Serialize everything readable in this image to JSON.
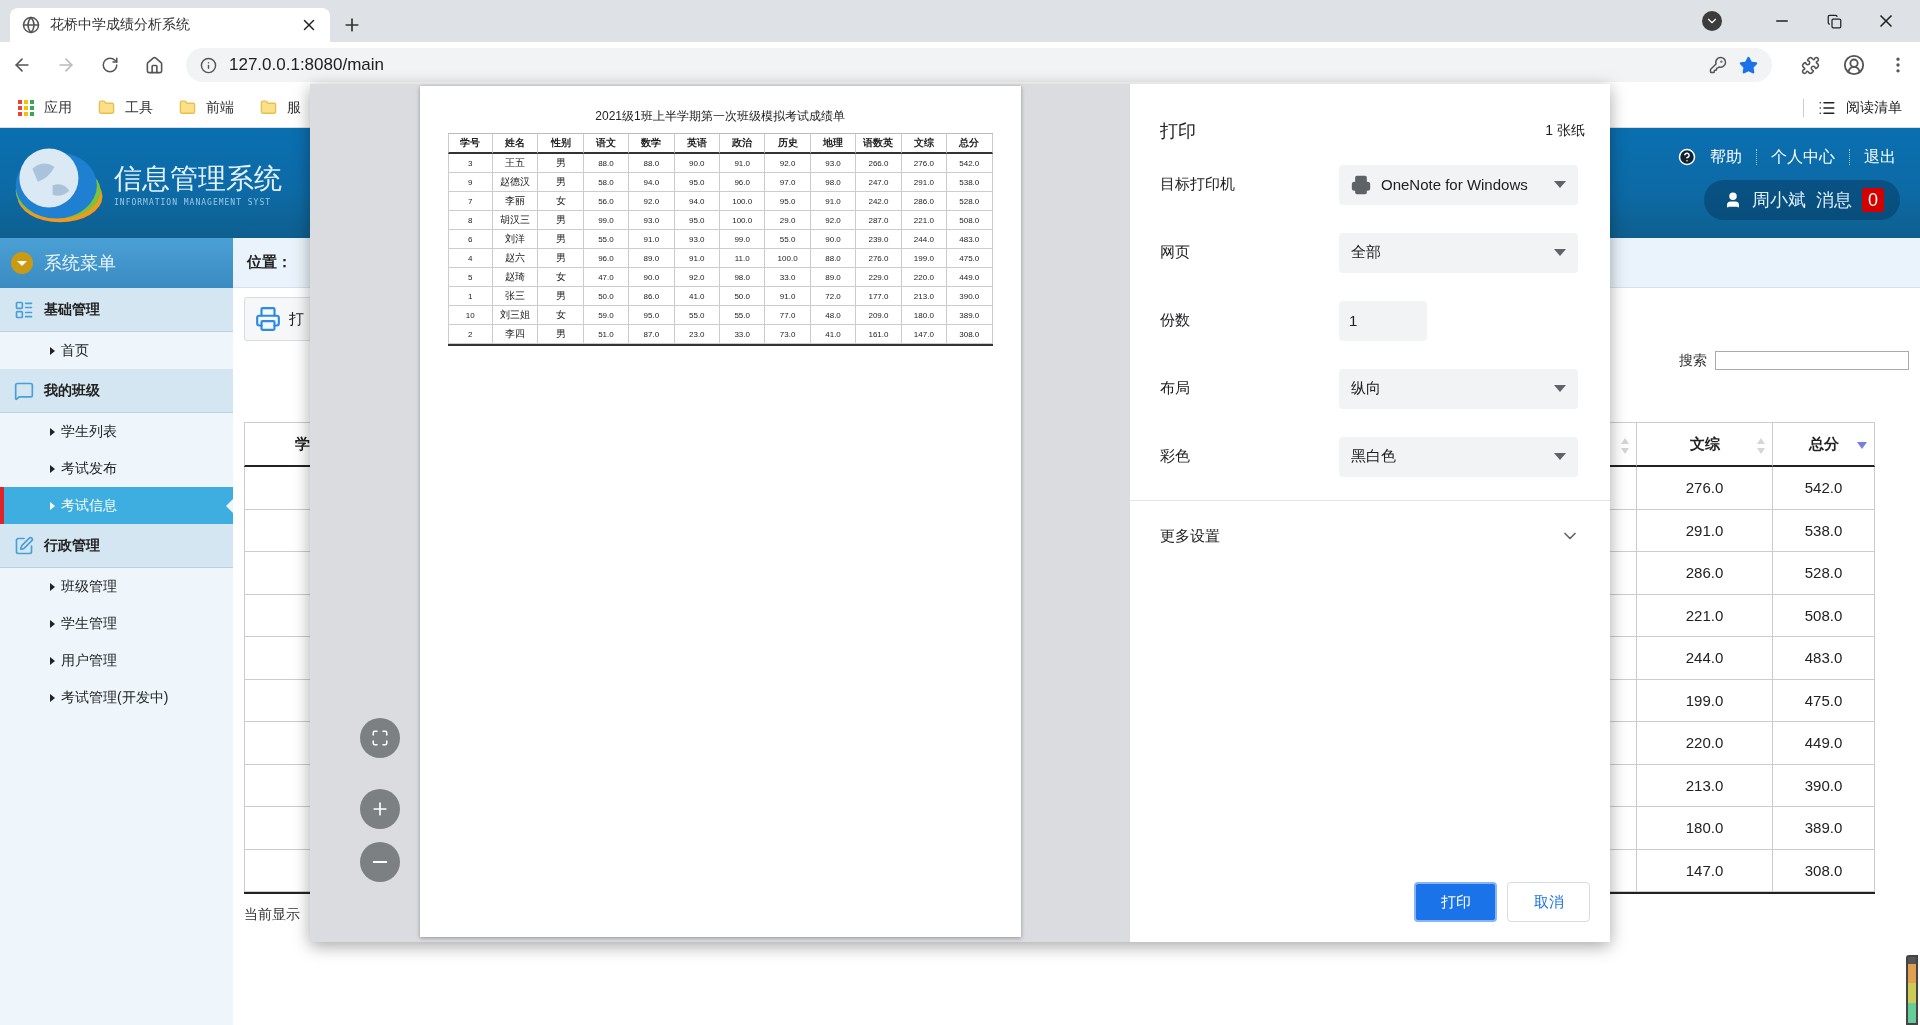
{
  "browser": {
    "tab_title": "花桥中学成绩分析系统",
    "url": "127.0.0.1:8080/main",
    "bookmarked": true,
    "bookmarks": [
      {
        "label": "应用",
        "kind": "apps"
      },
      {
        "label": "工具",
        "kind": "folder"
      },
      {
        "label": "前端",
        "kind": "folder"
      },
      {
        "label": "服",
        "kind": "folder"
      }
    ],
    "reading_list": "阅读清单"
  },
  "header": {
    "title": "信息管理系统",
    "subtitle": "INFORMATION MANAGEMENT SYST",
    "links": [
      {
        "label": "帮助",
        "kind": "help"
      },
      {
        "label": "个人中心",
        "kind": "plain"
      },
      {
        "label": "退出",
        "kind": "plain"
      }
    ],
    "user": "周小斌",
    "messages_label": "消息",
    "message_count": "0"
  },
  "sidebar": {
    "title": "系统菜单",
    "groups": [
      {
        "label": "基础管理",
        "items": [
          {
            "label": "首页",
            "selected": false
          }
        ]
      },
      {
        "label": "我的班级",
        "items": [
          {
            "label": "学生列表",
            "selected": false
          },
          {
            "label": "考试发布",
            "selected": false
          },
          {
            "label": "考试信息",
            "selected": true
          }
        ]
      },
      {
        "label": "行政管理",
        "items": [
          {
            "label": "班级管理",
            "selected": false
          },
          {
            "label": "学生管理",
            "selected": false
          },
          {
            "label": "用户管理",
            "selected": false
          },
          {
            "label": "考试管理(开发中)",
            "selected": false
          }
        ]
      }
    ]
  },
  "main": {
    "location_label": "位置：",
    "print_button": "打",
    "search_label": "搜索",
    "table": {
      "columns": [
        {
          "label": "学"
        },
        {
          "sortable": true,
          "sorted": false
        },
        {
          "label": "文综",
          "sortable": true,
          "sorted": false
        },
        {
          "label": "总分",
          "sortable": true,
          "sorted": true
        }
      ],
      "rows": [
        [
          "276.0",
          "542.0"
        ],
        [
          "291.0",
          "538.0"
        ],
        [
          "286.0",
          "528.0"
        ],
        [
          "221.0",
          "508.0"
        ],
        [
          "244.0",
          "483.0"
        ],
        [
          "199.0",
          "475.0"
        ],
        [
          "220.0",
          "449.0"
        ],
        [
          "213.0",
          "390.0"
        ],
        [
          "180.0",
          "389.0"
        ],
        [
          "147.0",
          "308.0"
        ]
      ]
    },
    "footer": "当前显示"
  },
  "print_dialog": {
    "title": "打印",
    "sheets": "1 张纸",
    "settings": [
      {
        "label": "目标打印机",
        "kind": "printer",
        "value": "OneNote for Windows"
      },
      {
        "label": "网页",
        "kind": "select",
        "value": "全部"
      },
      {
        "label": "份数",
        "kind": "input",
        "value": "1"
      },
      {
        "label": "布局",
        "kind": "select",
        "value": "纵向"
      },
      {
        "label": "彩色",
        "kind": "select",
        "value": "黑白色"
      }
    ],
    "more_settings": {
      "label": "更多设置",
      "expanded": false
    },
    "buttons": [
      {
        "label": "打印",
        "kind": "primary"
      },
      {
        "label": "取消",
        "kind": "secondary"
      }
    ],
    "preview": {
      "title": "2021级1班上半学期第一次班级模拟考试成绩单",
      "columns": [
        "学号",
        "姓名",
        "性别",
        "语文",
        "数学",
        "英语",
        "政治",
        "历史",
        "地理",
        "语数英",
        "文综",
        "总分"
      ],
      "rows": [
        [
          "3",
          "王五",
          "男",
          "88.0",
          "88.0",
          "90.0",
          "91.0",
          "92.0",
          "93.0",
          "266.0",
          "276.0",
          "542.0"
        ],
        [
          "9",
          "赵德汉",
          "男",
          "58.0",
          "94.0",
          "95.0",
          "96.0",
          "97.0",
          "98.0",
          "247.0",
          "291.0",
          "538.0"
        ],
        [
          "7",
          "李丽",
          "女",
          "56.0",
          "92.0",
          "94.0",
          "100.0",
          "95.0",
          "91.0",
          "242.0",
          "286.0",
          "528.0"
        ],
        [
          "8",
          "胡汉三",
          "男",
          "99.0",
          "93.0",
          "95.0",
          "100.0",
          "29.0",
          "92.0",
          "287.0",
          "221.0",
          "508.0"
        ],
        [
          "6",
          "刘洋",
          "男",
          "55.0",
          "91.0",
          "93.0",
          "99.0",
          "55.0",
          "90.0",
          "239.0",
          "244.0",
          "483.0"
        ],
        [
          "4",
          "赵六",
          "男",
          "96.0",
          "89.0",
          "91.0",
          "11.0",
          "100.0",
          "88.0",
          "276.0",
          "199.0",
          "475.0"
        ],
        [
          "5",
          "赵琦",
          "女",
          "47.0",
          "90.0",
          "92.0",
          "98.0",
          "33.0",
          "89.0",
          "229.0",
          "220.0",
          "449.0"
        ],
        [
          "1",
          "张三",
          "男",
          "50.0",
          "86.0",
          "41.0",
          "50.0",
          "91.0",
          "72.0",
          "177.0",
          "213.0",
          "390.0"
        ],
        [
          "10",
          "刘三姐",
          "女",
          "59.0",
          "95.0",
          "55.0",
          "55.0",
          "77.0",
          "48.0",
          "209.0",
          "180.0",
          "389.0"
        ],
        [
          "2",
          "李四",
          "男",
          "51.0",
          "87.0",
          "23.0",
          "33.0",
          "73.0",
          "41.0",
          "161.0",
          "147.0",
          "308.0"
        ]
      ]
    }
  }
}
